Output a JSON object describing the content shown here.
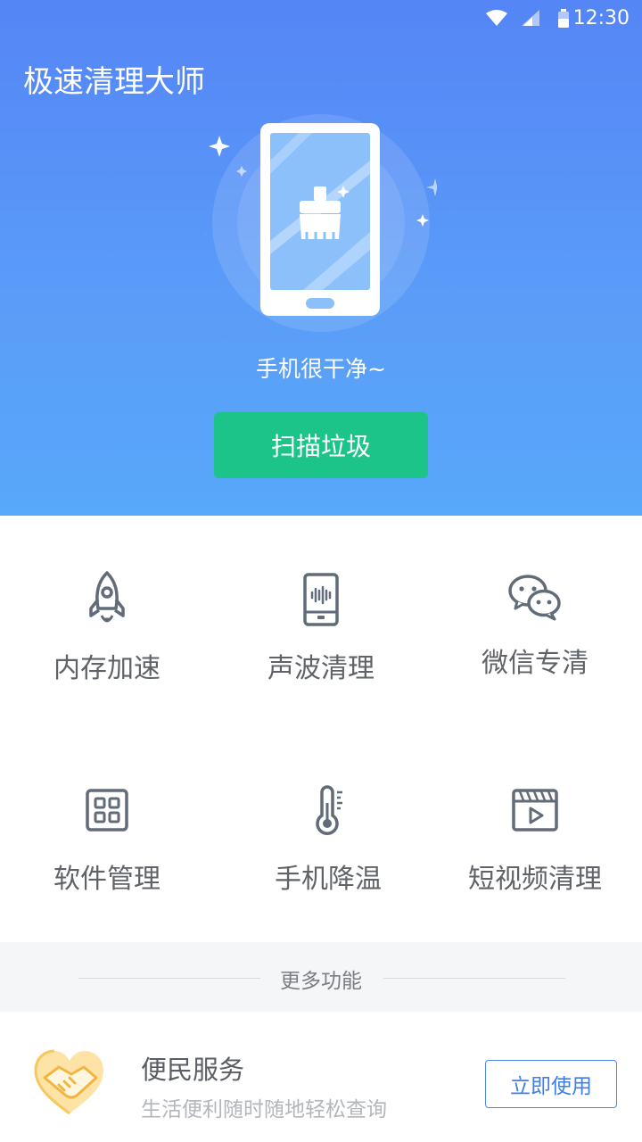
{
  "status_bar": {
    "time": "12:30"
  },
  "app": {
    "title": "极速清理大师"
  },
  "hero": {
    "status_text": "手机很干净~",
    "scan_button": "扫描垃圾"
  },
  "tools": [
    {
      "label": "内存加速",
      "icon": "rocket-icon"
    },
    {
      "label": "声波清理",
      "icon": "sound-wave-phone-icon"
    },
    {
      "label": "微信专清",
      "icon": "wechat-icon"
    },
    {
      "label": "软件管理",
      "icon": "app-grid-icon"
    },
    {
      "label": "手机降温",
      "icon": "thermometer-icon"
    },
    {
      "label": "短视频清理",
      "icon": "video-clapper-icon"
    }
  ],
  "more": {
    "label": "更多功能"
  },
  "service": {
    "title": "便民服务",
    "subtitle": "生活便利随时随地轻松查询",
    "button": "立即使用",
    "icon": "handshake-heart-icon"
  },
  "colors": {
    "hero_top": "#5585f6",
    "hero_bottom": "#58a8fb",
    "scan_button": "#1cc48a",
    "accent_blue": "#3f7fe6"
  }
}
